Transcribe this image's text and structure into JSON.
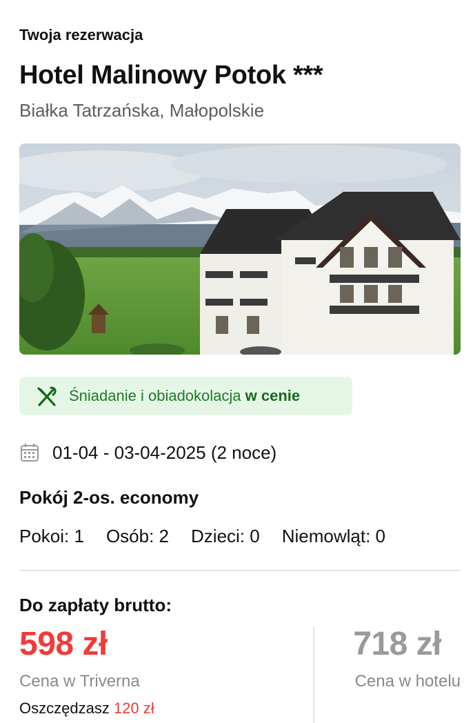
{
  "header": {
    "kicker": "Twoja rezerwacja",
    "hotel_name": "Hotel Malinowy Potok ***",
    "location": "Białka Tatrzańska, Małopolskie"
  },
  "photo": {
    "description_icon": "hotel-photo"
  },
  "meal": {
    "icon": "utensils-icon",
    "text": "Śniadanie i obiadokolacja",
    "emphasis": "w cenie",
    "accent": "#1e7a2a",
    "background": "#e6f6e6"
  },
  "stay": {
    "icon": "calendar-icon",
    "dates": "01-04 - 03-04-2025 (2 noce)"
  },
  "room": {
    "name": "Pokój 2-os. economy",
    "occupancy": [
      "Pokoi: 1",
      "Osób: 2",
      "Dzieci: 0",
      "Niemowląt: 0"
    ]
  },
  "payment": {
    "label": "Do zapłaty brutto:",
    "price": "598 zł",
    "price_label": "Cena w Triverna",
    "savings_prefix": "Oszczędzasz",
    "savings_amount": "120 zł",
    "hotel_price": "718 zł",
    "hotel_price_label": "Cena w hotelu",
    "accent": "#f13a3a"
  }
}
